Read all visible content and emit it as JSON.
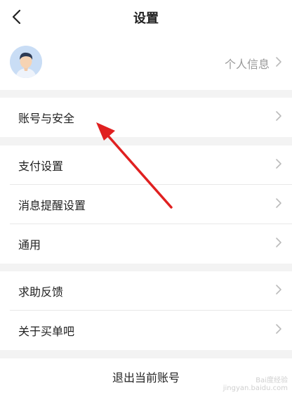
{
  "header": {
    "title": "设置"
  },
  "profile": {
    "label": "个人信息"
  },
  "sections": [
    {
      "items": [
        "账号与安全"
      ]
    },
    {
      "items": [
        "支付设置",
        "消息提醒设置",
        "通用"
      ]
    },
    {
      "items": [
        "求助反馈",
        "关于买单吧"
      ]
    }
  ],
  "logout": {
    "label": "退出当前账号"
  },
  "annotation": {
    "arrow_color": "#e02020"
  },
  "watermark": {
    "line1": "Bai度经验",
    "line2": "jingyan.baidu.com"
  }
}
